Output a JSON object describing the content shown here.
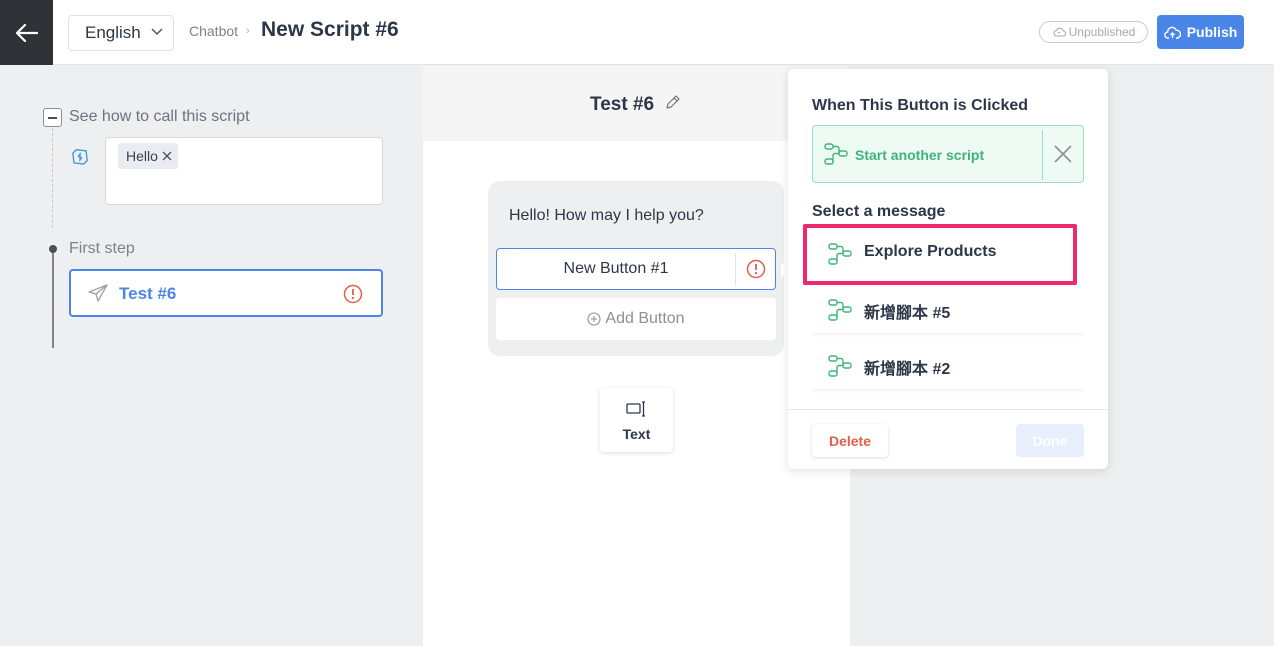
{
  "header": {
    "language": "English",
    "breadcrumb": "Chatbot",
    "title": "New Script #6",
    "status_badge": "Unpublished",
    "publish_label": "Publish"
  },
  "sidebar": {
    "call_label": "See how to call this script",
    "keywords": [
      "Hello"
    ],
    "first_step_label": "First step",
    "step_name": "Test #6"
  },
  "canvas": {
    "title": "Test #6",
    "message": "Hello! How may I help you?",
    "button_label": "New Button #1",
    "add_button_label": "Add Button",
    "text_tool_label": "Text"
  },
  "panel": {
    "title": "When This Button is Clicked",
    "action_label": "Start another script",
    "select_label": "Select a message",
    "messages": [
      "Explore Products",
      "新增腳本 #5",
      "新增腳本 #2"
    ],
    "delete_label": "Delete",
    "done_label": "Done"
  },
  "colors": {
    "accent": "#4a86e8",
    "success": "#3fb47a",
    "danger": "#e0604c",
    "highlight": "#f0286e"
  }
}
